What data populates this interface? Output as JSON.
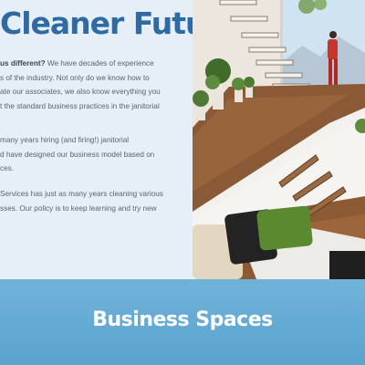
{
  "about": {
    "headline": "Cleaner Future",
    "para1": {
      "lead": "us different?",
      "rest_1": " We have decades of experience",
      "line_2": "s of the industry. Not only do we know how to",
      "line_3": "ate our associates, we also know everything you",
      "line_4": "t the standard business practices in the janitorial"
    },
    "para2": {
      "line_1": "many years hiring (and firing!) janitorial",
      "line_2": "d have designed our business model based on",
      "line_3": "ces."
    },
    "para3": {
      "line_1": "Services has just as many years cleaning various",
      "line_2": "sses. Our policy is to keep learning and try new"
    }
  },
  "section": {
    "title": "Business Spaces"
  },
  "colors": {
    "headline": "#2f6aa3",
    "text_panel_bg": "#e6eef7",
    "band": "#5aa3cf"
  }
}
